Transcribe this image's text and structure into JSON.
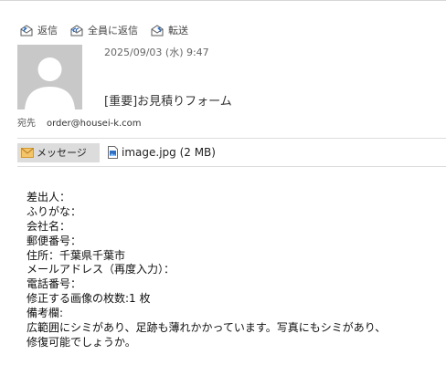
{
  "toolbar": {
    "reply_label": "返信",
    "reply_all_label": "全員に返信",
    "forward_label": "転送"
  },
  "message": {
    "datetime": "2025/09/03 (水) 9:47",
    "subject": "[重要]お見積りフォーム",
    "to_label": "宛先",
    "to_address": "order@housei-k.com"
  },
  "attachments": {
    "message_tab_label": "メッセージ",
    "file_label": "image.jpg (2 MB)"
  },
  "body_lines": [
    "差出人：",
    "ふりがな：",
    "会社名：",
    "郵便番号：",
    "住所：千葉県千葉市",
    "メールアドレス（再度入力）：",
    "電話番号：",
    "修正する画像の枚数:1 枚",
    "備考欄:",
    "広範囲にシミがあり、足跡も薄れかかっています。写真にもシミがあり、",
    "修復可能でしょうか。"
  ],
  "colors": {
    "avatar_bg": "#c8c8c8",
    "message_tab_bg": "#dcdcdc",
    "envelope_icon": "#e8b04b",
    "file_icon": "#2f6fc1"
  }
}
